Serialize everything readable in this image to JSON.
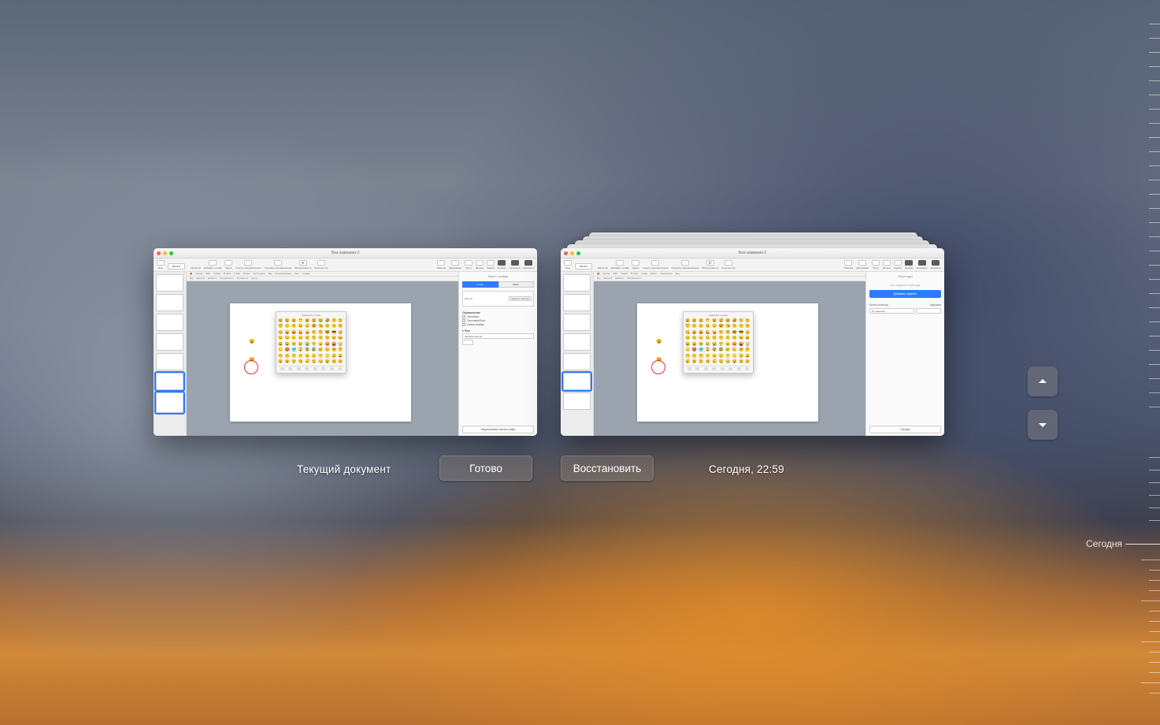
{
  "window_title": "Без названия 2",
  "labels": {
    "current_document": "Текущий документ",
    "version_timestamp": "Сегодня, 22:59",
    "done_button": "Готово",
    "restore_button": "Восстановить",
    "timeline_today": "Сегодня"
  },
  "toolbar": {
    "zoom": "84 % ▾",
    "items_left": [
      {
        "label": "Вид",
        "icon": "grid"
      },
      {
        "label": "Масштаб",
        "icon": "zoom"
      },
      {
        "label": "Добавить слайд",
        "icon": "plus"
      },
      {
        "label": "Цвета",
        "icon": "palette"
      },
      {
        "label": "Скрыть направляющие",
        "icon": "guides"
      },
      {
        "label": "Показать направляющие",
        "icon": "guides2"
      },
      {
        "label": "Воспроизвести",
        "icon": "play"
      }
    ],
    "items_center": [
      {
        "label": "Редактировать",
        "icon": "edit"
      },
      {
        "label": "Keynote Live",
        "icon": "live"
      },
      {
        "label": "Ин в том",
        "icon": "info"
      }
    ],
    "items_right": [
      {
        "label": "Таблица",
        "icon": "table"
      },
      {
        "label": "Диаграмма",
        "icon": "chart"
      },
      {
        "label": "Текст",
        "icon": "text"
      },
      {
        "label": "Фигура",
        "icon": "shape"
      },
      {
        "label": "Медиа",
        "icon": "media"
      },
      {
        "label": "Формат",
        "icon": "format",
        "dark": true
      },
      {
        "label": "Анимация",
        "icon": "anim",
        "dark": true
      },
      {
        "label": "Документ",
        "icon": "doc",
        "dark": true
      }
    ]
  },
  "inner_menus": [
    "Keynote",
    "Файл",
    "Правка",
    "Вставка",
    "Слайд",
    "Формат",
    "Расположить",
    "Вид",
    "Воспроизведение",
    "Окно",
    "Справка"
  ],
  "inner_menus2": [
    "Вид",
    "Масштаб",
    "Добавить",
    "Воспроизвести",
    "Keynote Live",
    "Доступ"
  ],
  "inspector_left": {
    "title": "Макет слайда",
    "tabs": [
      "Стиль",
      "Макет"
    ],
    "master_name": "Пустой",
    "master_button": "Сменить мастер",
    "appearance_header": "Оформление",
    "rows": [
      "Заголовок",
      "Текстовый блок",
      "Номер слайда"
    ],
    "background_header": "Фон",
    "fill_label": "Заливка цветом",
    "edit_master_button": "Редактировать мастер-слайд"
  },
  "inspector_right": {
    "title": "Переходы",
    "no_effect": "Нет эффекта перехода",
    "add_effect": "Добавить эффект",
    "start_label": "Начать переход",
    "delay_label": "Задержка",
    "start_value": "По нажатию",
    "order_button": "Порядок"
  },
  "emoji_panel": {
    "title": "смайлики и люди",
    "grid": [
      "😀",
      "😃",
      "😄",
      "😁",
      "😆",
      "😅",
      "😂",
      "🤣",
      "☺️",
      "😊",
      "😇",
      "🙂",
      "🙃",
      "😉",
      "😌",
      "😍",
      "😘",
      "😗",
      "😙",
      "😚",
      "😋",
      "😛",
      "😝",
      "😜",
      "🤪",
      "🤨",
      "🧐",
      "🤓",
      "😎",
      "🥳",
      "😏",
      "😒",
      "😞",
      "😔",
      "😟",
      "😕",
      "🙁",
      "☹️",
      "😣",
      "😖",
      "😫",
      "😩",
      "🥺",
      "😢",
      "😭",
      "😤",
      "😠",
      "😡",
      "🤬",
      "🤯",
      "😳",
      "🥵",
      "🥶",
      "😱",
      "😨",
      "😰",
      "😥",
      "😓",
      "🤗",
      "🤔",
      "🤭",
      "🤫",
      "🤥",
      "😶",
      "😐",
      "😑",
      "😬",
      "🙄",
      "😯",
      "😦",
      "😧",
      "😮",
      "😲",
      "🥱",
      "😴",
      "🤤",
      "😪",
      "😵",
      "🤐",
      "🥴"
    ]
  }
}
